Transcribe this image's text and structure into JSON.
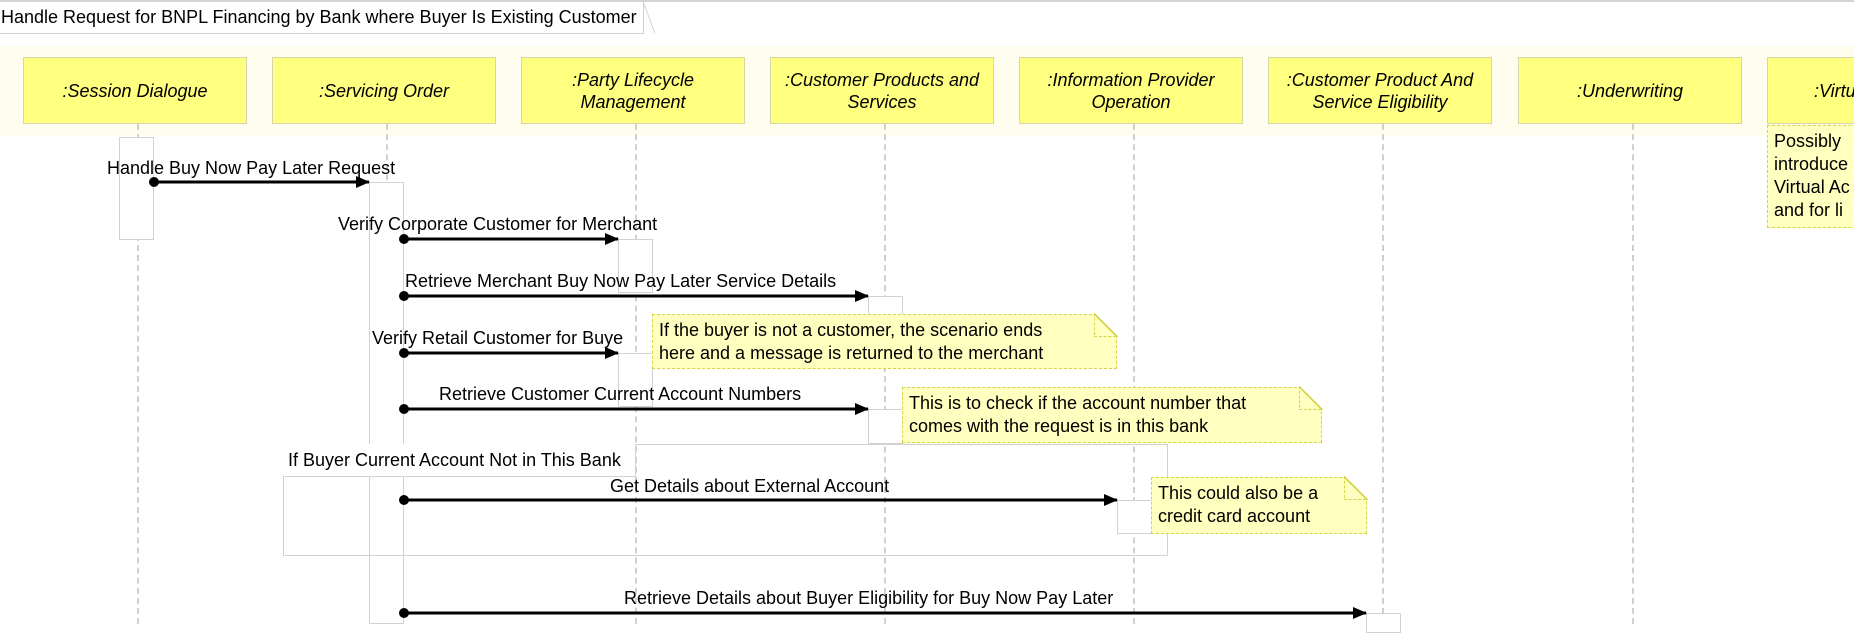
{
  "diagram": {
    "title": "Handle Request for BNPL Financing by Bank where Buyer Is Existing Customer",
    "type": "sequence",
    "lifelines": [
      {
        "id": "session-dialogue",
        "label": ":Session Dialogue"
      },
      {
        "id": "servicing-order",
        "label": ":Servicing Order"
      },
      {
        "id": "party-lifecycle-management",
        "label": ":Party Lifecycle Management"
      },
      {
        "id": "customer-products-and-services",
        "label": ":Customer Products and Services"
      },
      {
        "id": "information-provider-operation",
        "label": ":Information Provider Operation"
      },
      {
        "id": "customer-product-and-service-eligibility",
        "label": ":Customer Product And Service Eligibility"
      },
      {
        "id": "underwriting",
        "label": ":Underwriting"
      },
      {
        "id": "virtual",
        "label": ":Virtu"
      }
    ],
    "messages": [
      {
        "label": "Handle Buy Now Pay Later Request",
        "from": "session-dialogue",
        "to": "servicing-order"
      },
      {
        "label": "Verify Corporate Customer for Merchant",
        "from": "servicing-order",
        "to": "party-lifecycle-management"
      },
      {
        "label": "Retrieve Merchant Buy Now Pay Later Service Details",
        "from": "servicing-order",
        "to": "customer-products-and-services"
      },
      {
        "label": "Verify Retail Customer for Buye",
        "from": "servicing-order",
        "to": "party-lifecycle-management"
      },
      {
        "label": "Retrieve Customer Current Account Numbers",
        "from": "servicing-order",
        "to": "customer-products-and-services"
      },
      {
        "label": "Get Details about External Account",
        "from": "servicing-order",
        "to": "information-provider-operation"
      },
      {
        "label": "Retrieve Details about Buyer Eligibility for Buy Now Pay Later",
        "from": "servicing-order",
        "to": "customer-product-and-service-eligibility"
      }
    ],
    "fragment": {
      "label": "If Buyer Current Account Not in This Bank"
    },
    "notes": [
      {
        "lines": [
          "If the buyer is not a customer, the scenario ends",
          "here and a message is returned to the merchant"
        ]
      },
      {
        "lines": [
          "This is to check if the account number that",
          "comes with the request is in this bank"
        ]
      },
      {
        "lines": [
          "This could also be a",
          "credit card account"
        ]
      },
      {
        "lines": [
          "Possibly",
          "introduce",
          "Virtual Ac",
          "and for li"
        ]
      }
    ],
    "colors": {
      "lifeline_fill": "#ffff80",
      "note_fill": "#ffffc0",
      "note_border": "#d4d44a",
      "header_band": "#fffdee"
    }
  }
}
